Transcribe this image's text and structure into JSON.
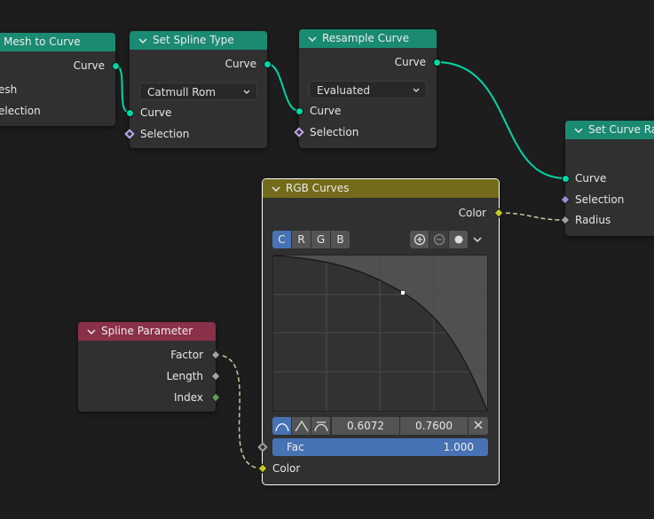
{
  "colors": {
    "geometry_header": "#1a8a72",
    "field_header": "#8a3048",
    "color_header": "#726c1a",
    "geometry_socket": "#00d6a3",
    "color_socket": "#c7c729",
    "accent": "#4772b3"
  },
  "mesh_to_curve": {
    "title": "Mesh to Curve",
    "out_curve": "Curve",
    "in_mesh": "esh",
    "in_selection": "election"
  },
  "set_spline_type": {
    "title": "Set Spline Type",
    "out_curve": "Curve",
    "dropdown": "Catmull Rom",
    "in_curve": "Curve",
    "in_selection": "Selection"
  },
  "resample_curve": {
    "title": "Resample Curve",
    "out_curve": "Curve",
    "dropdown": "Evaluated",
    "in_curve": "Curve",
    "in_selection": "Selection"
  },
  "set_curve_radius": {
    "title": "Set Curve Ra",
    "in_curve": "Curve",
    "in_selection": "Selection",
    "in_radius": "Radius"
  },
  "rgb_curves": {
    "title": "RGB Curves",
    "out_color": "Color",
    "channels": [
      "C",
      "R",
      "G",
      "B"
    ],
    "active_channel": "C",
    "point_x": "0.6072",
    "point_y": "0.7600",
    "fac_label": "Fac",
    "fac_value": "1.000",
    "in_color": "Color"
  },
  "spline_parameter": {
    "title": "Spline Parameter",
    "out_factor": "Factor",
    "out_length": "Length",
    "out_index": "Index"
  }
}
